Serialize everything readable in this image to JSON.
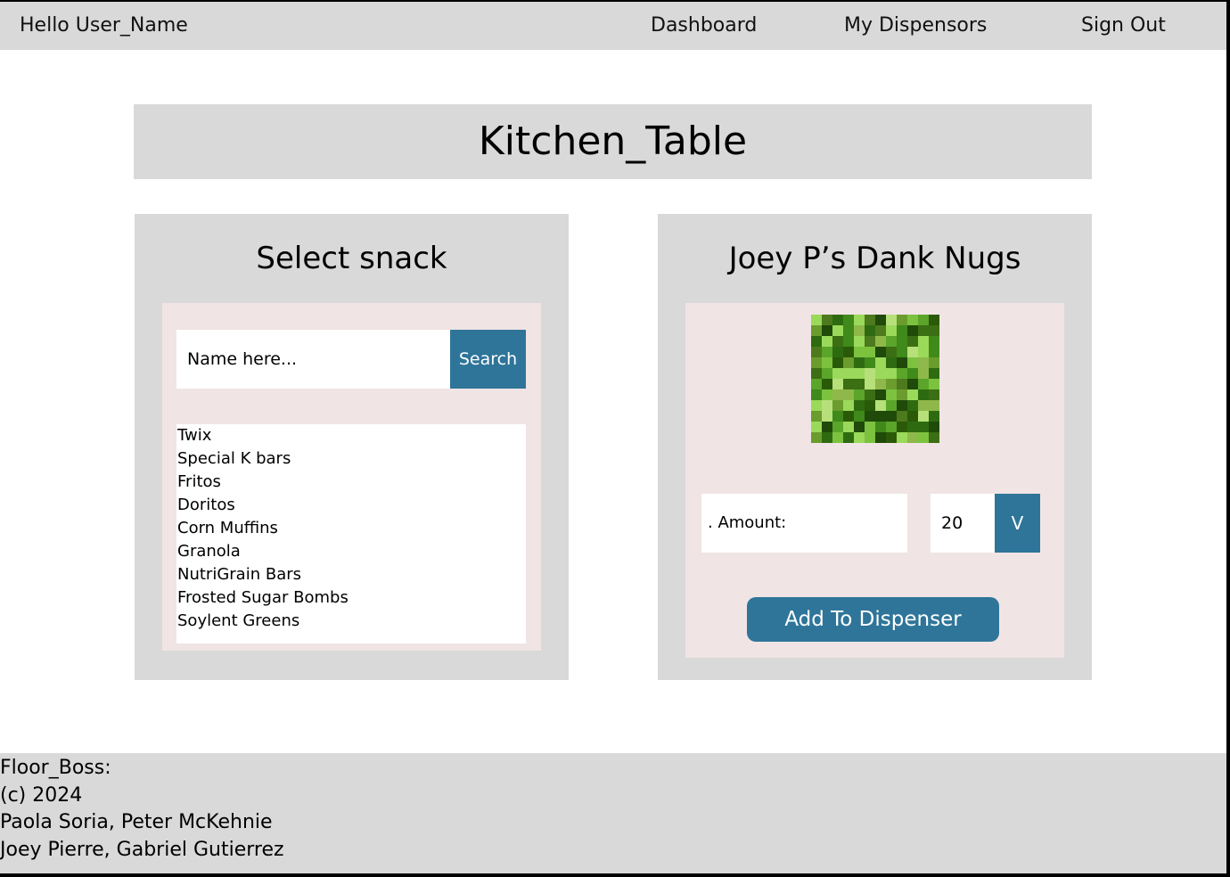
{
  "navbar": {
    "greeting": "Hello User_Name",
    "links": [
      "Dashboard",
      "My Dispensors",
      "Sign Out"
    ]
  },
  "page_title": "Kitchen_Table",
  "select_panel": {
    "title": "Select snack",
    "search": {
      "placeholder": "Name here...",
      "value": "",
      "button_label": "Search"
    },
    "snacks": [
      "Twix",
      "Special K bars",
      "Fritos",
      "Doritos",
      "Corn Muffins",
      "Granola",
      "NutriGrain Bars",
      "Frosted Sugar Bombs",
      "Soylent Greens"
    ]
  },
  "dispenser_panel": {
    "title": "Joey P’s Dank Nugs",
    "image_icon": "snack-image",
    "amount_label": ". Amount:",
    "amount_value": "20",
    "amount_chevron": "V",
    "add_button_label": "Add To Dispenser"
  },
  "footer": {
    "lines": [
      "Floor_Boss:",
      "(c) 2024",
      "Paola Soria, Peter McKehnie",
      "Joey Pierre, Gabriel Gutierrez"
    ]
  },
  "colors": {
    "background": "#ffffff",
    "panel": "#d9d9d9",
    "inner_panel": "#f0e4e4",
    "accent": "#2e7599"
  }
}
